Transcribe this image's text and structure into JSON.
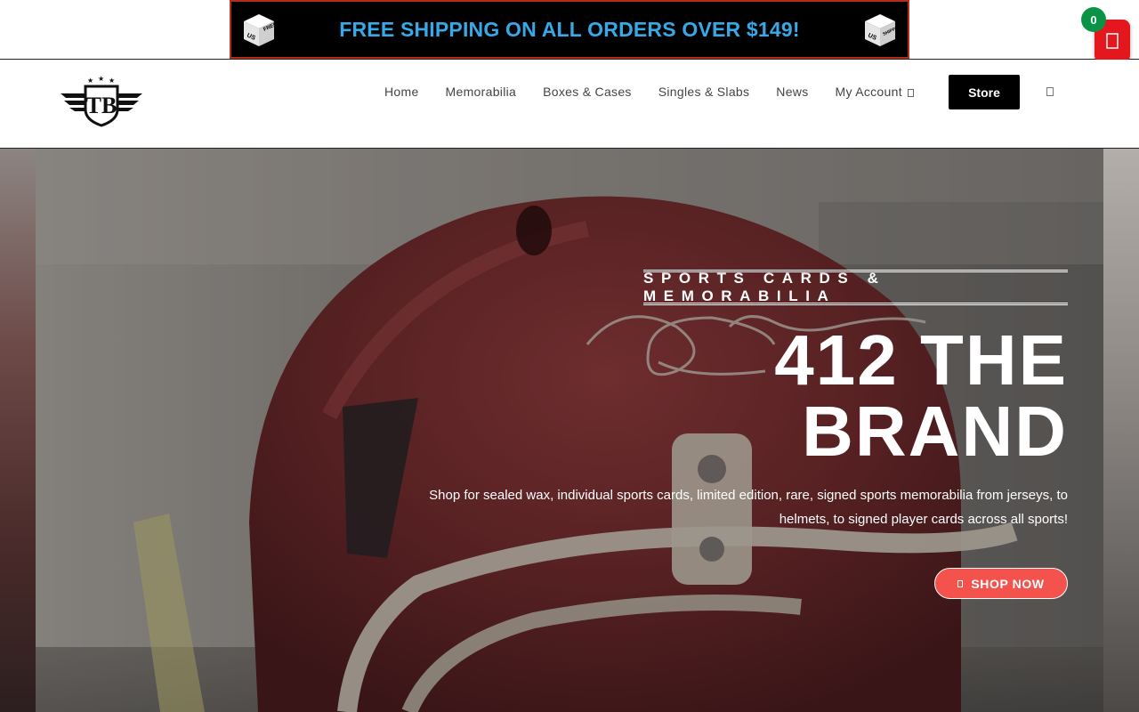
{
  "banner": {
    "text": "FREE SHIPPING ON ALL ORDERS OVER $149!",
    "badge_text_1": "FREE",
    "badge_text_2": "SHIPPING",
    "badge_text_3": "US",
    "icon": "free-shipping-box-icon",
    "text_color": "#36a9e8",
    "border_color": "#b52c1e"
  },
  "cart": {
    "count": "0",
    "icon": "cart-icon",
    "color": "#e4161e",
    "badge_color": "#0a9346"
  },
  "header": {
    "logo_text": "TB",
    "nav": {
      "home": "Home",
      "memorabilia": "Memorabilia",
      "boxes": "Boxes & Cases",
      "singles": "Singles & Slabs",
      "news": "News",
      "account": "My Account"
    },
    "store_label": "Store",
    "search_icon": "search-icon"
  },
  "hero": {
    "kicker": "SPORTS CARDS & MEMORABILIA",
    "title_line1": "412 THE",
    "title_line2": "BRAND",
    "description": "Shop for sealed wax, individual sports cards, limited edition, rare, signed sports memorabilia from jerseys, to helmets, to signed player cards across all sports!",
    "cta_label": "SHOP NOW",
    "cta_color": "#f4524d"
  }
}
